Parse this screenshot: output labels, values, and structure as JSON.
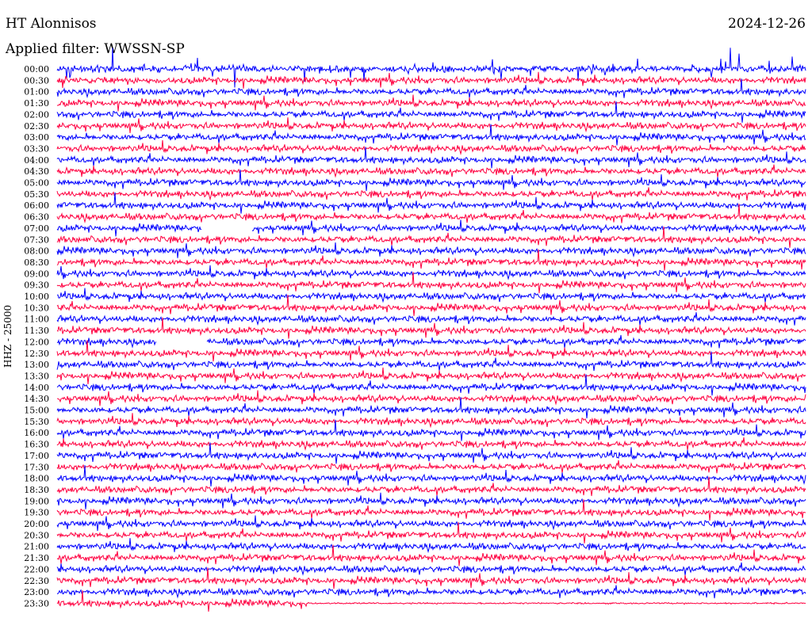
{
  "header": {
    "station": "HT Alonnisos",
    "date": "2024-12-26",
    "filter": "Applied filter: WWSSN-SP",
    "channel_label": "HHZ - 25000"
  },
  "colors": {
    "trace_a": "#0000ff",
    "trace_b": "#ff0040",
    "background": "#ffffff"
  },
  "chart_data": {
    "type": "line",
    "title": "HT Alonnisos",
    "date": "2024-12-26",
    "filter": "WWSSN-SP",
    "ylabel": "HHZ - 25000",
    "xlabel": "",
    "grid": false,
    "traces_per_hour": 2,
    "trace_duration_minutes": 30,
    "trace_colors_alternating": [
      "#0000ff",
      "#ff0040"
    ],
    "row_labels": [
      "00:00",
      "00:30",
      "01:00",
      "01:30",
      "02:00",
      "02:30",
      "03:00",
      "03:30",
      "04:00",
      "04:30",
      "05:00",
      "05:30",
      "06:00",
      "06:30",
      "07:00",
      "07:30",
      "08:00",
      "08:30",
      "09:00",
      "09:30",
      "10:00",
      "10:30",
      "11:00",
      "11:30",
      "12:00",
      "12:30",
      "13:00",
      "13:30",
      "14:00",
      "14:30",
      "15:00",
      "15:30",
      "16:00",
      "16:30",
      "17:00",
      "17:30",
      "18:00",
      "18:30",
      "19:00",
      "19:30",
      "20:00",
      "20:30",
      "21:00",
      "21:30",
      "22:00",
      "22:30",
      "23:00",
      "23:30"
    ],
    "data_gaps": [
      {
        "row": "07:00",
        "from_min": 5.8,
        "to_min": 7.8
      },
      {
        "row": "12:00",
        "from_min": 4.0,
        "to_min": 6.0
      }
    ],
    "last_trace_end_min": 10.1
  }
}
